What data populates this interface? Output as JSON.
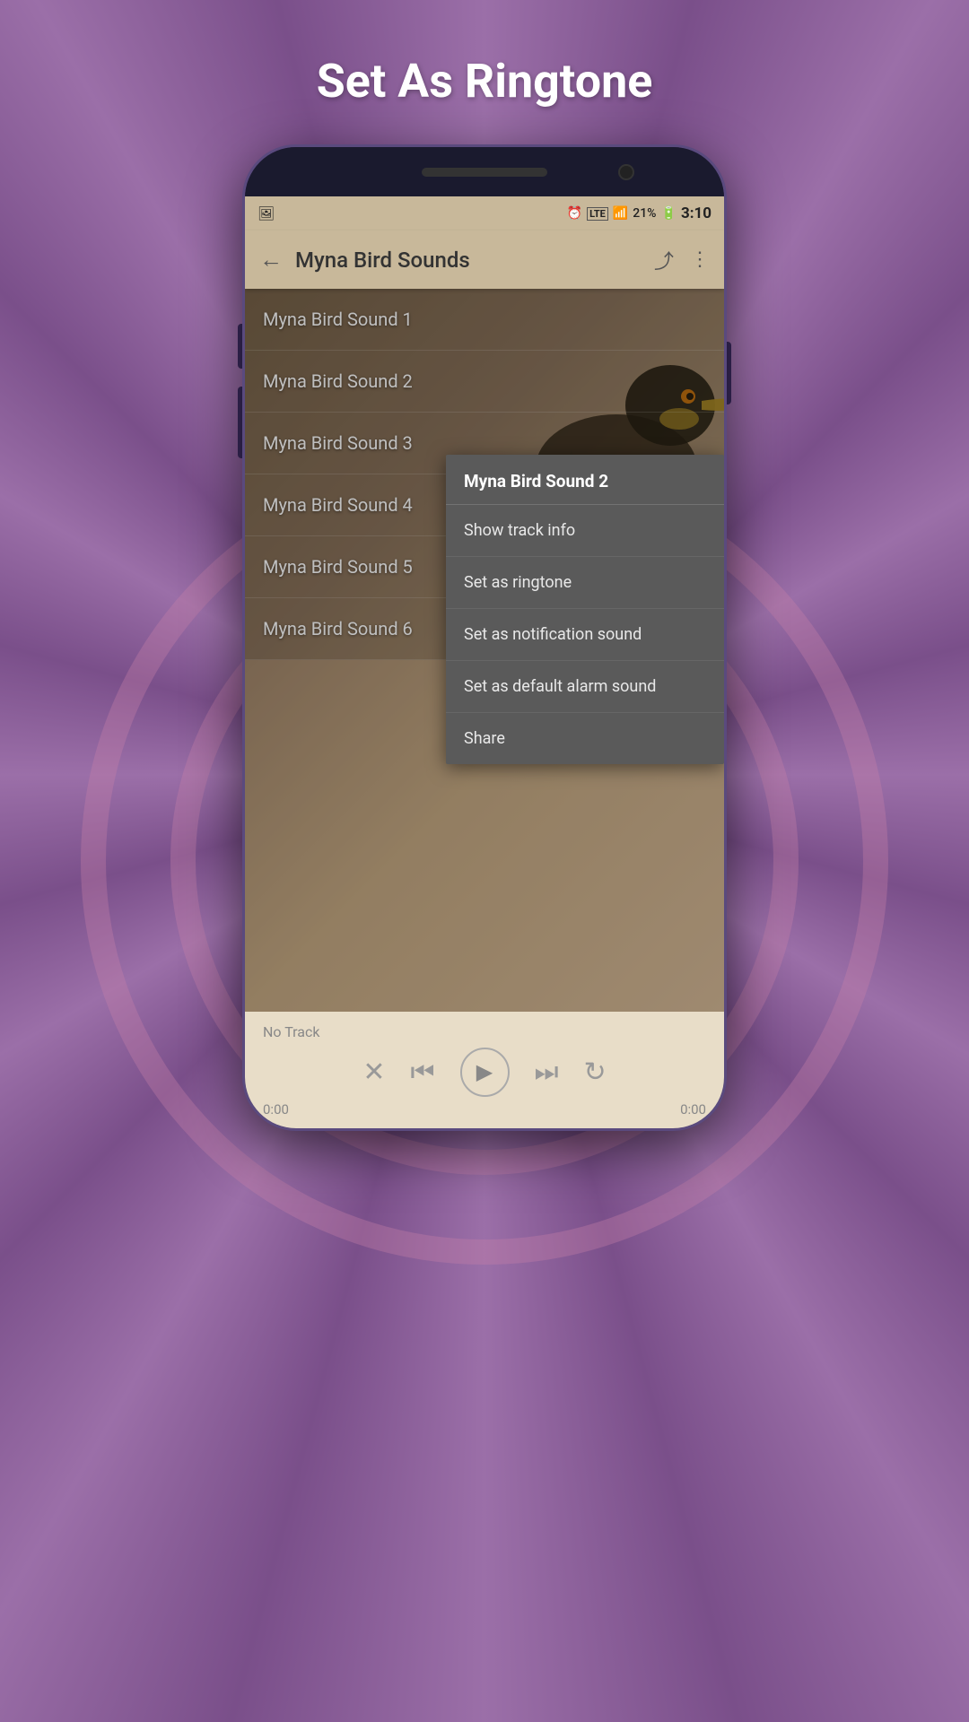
{
  "page": {
    "title": "Set As Ringtone",
    "background_color": "#7b5a8a"
  },
  "status_bar": {
    "left_icon": "📷",
    "alarm": "⏰",
    "lte": "LTE",
    "signal": "📶",
    "battery_percent": "21%",
    "time": "3:10"
  },
  "app_bar": {
    "title": "Myna Bird Sounds",
    "back_label": "←",
    "share_label": "⤴",
    "menu_label": "⋮"
  },
  "tracks": [
    {
      "id": 1,
      "label": "Myna Bird Sound 1"
    },
    {
      "id": 2,
      "label": "Myna Bird Sound 2"
    },
    {
      "id": 3,
      "label": "Myna Bird Sound 3"
    },
    {
      "id": 4,
      "label": "Myna Bird Sound 4"
    },
    {
      "id": 5,
      "label": "Myna Bird Sound 5"
    },
    {
      "id": 6,
      "label": "Myna Bird Sound 6"
    }
  ],
  "context_menu": {
    "title": "Myna Bird Sound 2",
    "items": [
      {
        "id": "show-track-info",
        "label": "Show track info"
      },
      {
        "id": "set-ringtone",
        "label": "Set as ringtone"
      },
      {
        "id": "set-notification",
        "label": "Set as notification sound"
      },
      {
        "id": "set-alarm",
        "label": "Set as default alarm sound"
      },
      {
        "id": "share",
        "label": "Share"
      }
    ]
  },
  "player": {
    "no_track_label": "No Track",
    "time_start": "0:00",
    "time_end": "0:00",
    "shuffle_icon": "✕",
    "prev_icon": "⏮",
    "play_icon": "▶",
    "next_icon": "⏭",
    "repeat_icon": "↻"
  }
}
